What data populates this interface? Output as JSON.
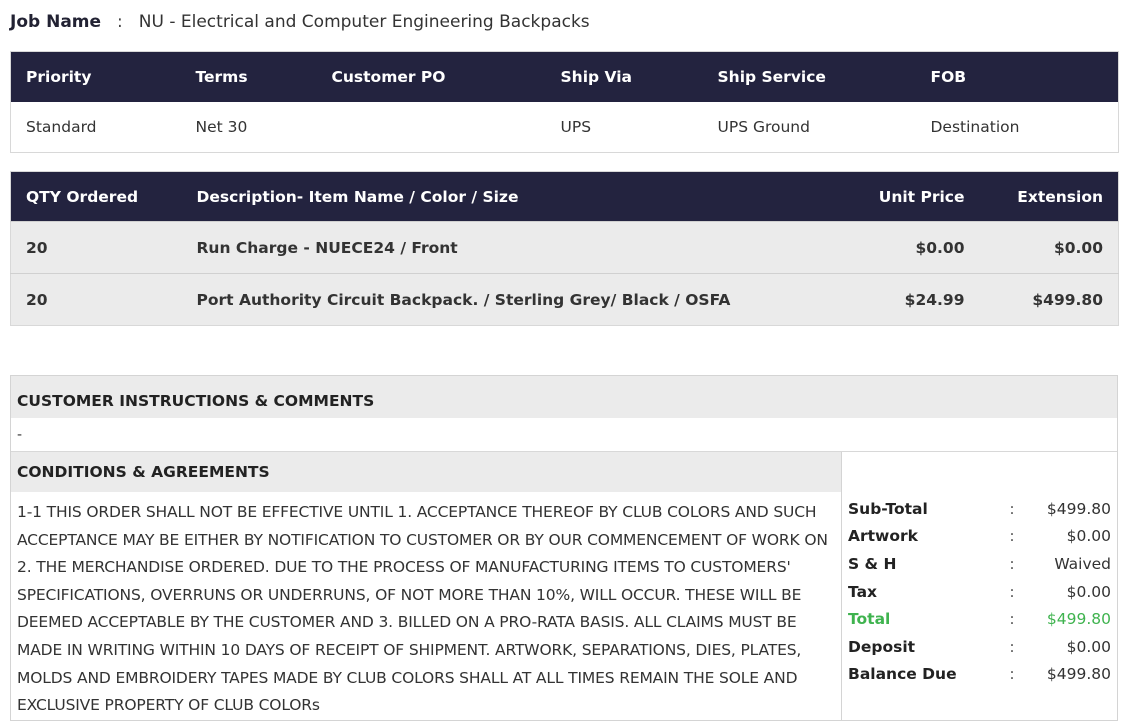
{
  "job": {
    "label": "Job Name",
    "colon": ":",
    "value": "NU - Electrical and Computer Engineering Backpacks"
  },
  "shipping": {
    "headers": [
      "Priority",
      "Terms",
      "Customer PO",
      "Ship Via",
      "Ship Service",
      "FOB"
    ],
    "values": [
      "Standard",
      "Net 30",
      "",
      "UPS",
      "UPS Ground",
      "Destination"
    ]
  },
  "items": {
    "headers": [
      "QTY Ordered",
      "Description- Item Name / Color / Size",
      "Unit Price",
      "Extension"
    ],
    "rows": [
      {
        "qty": "20",
        "description": "Run Charge - NUECE24 / Front",
        "unit_price": "$0.00",
        "extension": "$0.00"
      },
      {
        "qty": "20",
        "description": "Port Authority Circuit Backpack. / Sterling Grey/ Black / OSFA",
        "unit_price": "$24.99",
        "extension": "$499.80"
      }
    ]
  },
  "instructions": {
    "title": "CUSTOMER INSTRUCTIONS & COMMENTS",
    "text": "-"
  },
  "conditions": {
    "title": "CONDITIONS & AGREEMENTS",
    "text": "1-1 THIS ORDER SHALL NOT BE EFFECTIVE UNTIL 1. ACCEPTANCE THEREOF BY CLUB COLORS AND SUCH ACCEPTANCE MAY BE EITHER BY NOTIFICATION TO CUSTOMER OR BY OUR COMMENCEMENT OF WORK ON 2. THE MERCHANDISE ORDERED. DUE TO THE PROCESS OF MANUFACTURING ITEMS TO CUSTOMERS' SPECIFICATIONS, OVERRUNS OR UNDERRUNS, OF NOT MORE THAN 10%, WILL OCCUR. THESE WILL BE DEEMED ACCEPTABLE BY THE CUSTOMER AND 3. BILLED ON A PRO-RATA BASIS. ALL CLAIMS MUST BE MADE IN WRITING WITHIN 10 DAYS OF RECEIPT OF SHIPMENT. ARTWORK, SEPARATIONS, DIES, PLATES, MOLDS AND EMBROIDERY TAPES MADE BY CLUB COLORS SHALL AT ALL TIMES REMAIN THE SOLE AND EXCLUSIVE PROPERTY OF CLUB COLORs"
  },
  "totals": {
    "colon": ":",
    "rows": [
      {
        "label": "Sub-Total",
        "value": "$499.80"
      },
      {
        "label": "Artwork",
        "value": "$0.00"
      },
      {
        "label": "S & H",
        "value": "Waived"
      },
      {
        "label": "Tax",
        "value": "$0.00"
      },
      {
        "label": "Total",
        "value": "$499.80"
      },
      {
        "label": "Deposit",
        "value": "$0.00"
      },
      {
        "label": "Balance Due",
        "value": "$499.80"
      }
    ],
    "highlight_color": "#3fb34f"
  },
  "colors": {
    "header_bg": "#23233f",
    "row_bg": "#ebebeb"
  }
}
